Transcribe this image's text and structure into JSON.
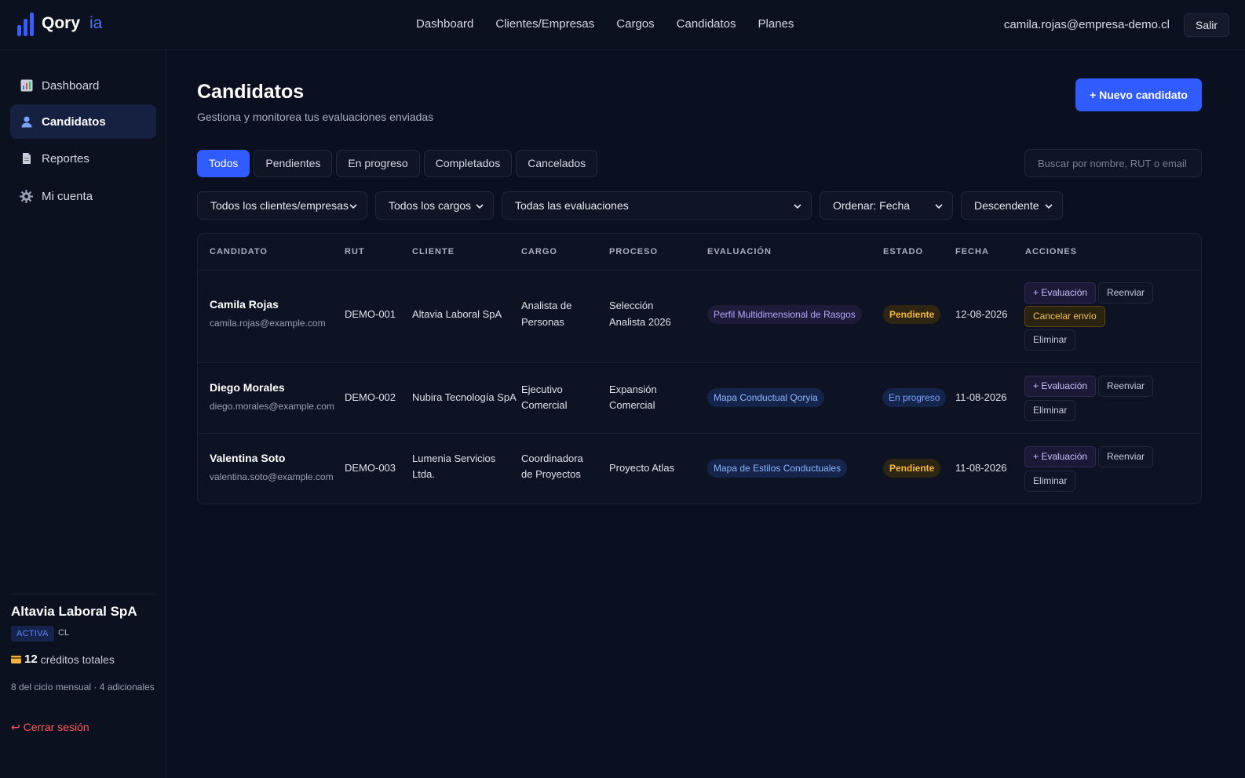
{
  "app": {
    "logo_main": "Qory",
    "logo_accent": "ia"
  },
  "topnav": [
    "Dashboard",
    "Clientes/Empresas",
    "Cargos",
    "Candidatos",
    "Planes"
  ],
  "user": {
    "email": "camila.rojas@empresa-demo.cl",
    "logout_label": "Salir"
  },
  "sidebar": {
    "items": [
      {
        "label": "Dashboard",
        "icon": "chart-icon"
      },
      {
        "label": "Candidatos",
        "icon": "user-icon",
        "active": true
      },
      {
        "label": "Reportes",
        "icon": "document-icon"
      },
      {
        "label": "Mi cuenta",
        "icon": "gear-icon"
      }
    ],
    "company": {
      "name": "Altavia Laboral SpA",
      "status": "ACTIVA",
      "country": "CL",
      "credits_count": "12",
      "credits_label": "créditos totales",
      "cycle": "8 del ciclo mensual · 4 adicionales"
    },
    "logout": "↩ Cerrar sesión"
  },
  "page": {
    "title": "Candidatos",
    "subtitle": "Gestiona y monitorea tus evaluaciones enviadas",
    "new_button": "+ Nuevo candidato"
  },
  "tabs": [
    "Todos",
    "Pendientes",
    "En progreso",
    "Completados",
    "Cancelados"
  ],
  "search": {
    "placeholder": "Buscar por nombre, RUT o email"
  },
  "filters": {
    "cliente": "Todos los clientes/empresas",
    "cargo": "Todos los cargos",
    "evaluacion": "Todas las evaluaciones",
    "orden": "Ordenar: Fecha",
    "direccion": "Descendente"
  },
  "table": {
    "headers": [
      "CANDIDATO",
      "RUT",
      "CLIENTE",
      "CARGO",
      "PROCESO",
      "EVALUACIÓN",
      "ESTADO",
      "FECHA",
      "ACCIONES"
    ],
    "rows": [
      {
        "name": "Camila Rojas",
        "email": "camila.rojas@example.com",
        "rut": "DEMO-001",
        "cliente": [
          "Altavia Laboral SpA"
        ],
        "cargo": [
          "Analista de",
          "Personas"
        ],
        "proceso": [
          "Selección",
          "Analista 2026"
        ],
        "evaluacion": "Perfil Multidimensional de Rasgos",
        "estado": "Pendiente",
        "fecha": "12-08-2026",
        "acciones": {
          "evaluacion": "+ Evaluación",
          "reenviar": "Reenviar",
          "cancelar": "Cancelar envío",
          "eliminar": "Eliminar"
        }
      },
      {
        "name": "Diego Morales",
        "email": "diego.morales@example.com",
        "rut": "DEMO-002",
        "cliente": [
          "Nubira Tecnología SpA"
        ],
        "cargo": [
          "Ejecutivo",
          "Comercial"
        ],
        "proceso": [
          "Expansión",
          "Comercial"
        ],
        "evaluacion": "Mapa Conductual Qoryia",
        "estado": "En progreso",
        "fecha": "11-08-2026",
        "acciones": {
          "evaluacion": "+ Evaluación",
          "reenviar": "Reenviar",
          "eliminar": "Eliminar"
        }
      },
      {
        "name": "Valentina Soto",
        "email": "valentina.soto@example.com",
        "rut": "DEMO-003",
        "cliente": [
          "Lumenia Servicios",
          "Ltda."
        ],
        "cargo": [
          "Coordinadora",
          "de Proyectos"
        ],
        "proceso": [
          "Proyecto Atlas"
        ],
        "evaluacion": "Mapa de Estilos Conductuales",
        "estado": "Pendiente",
        "fecha": "11-08-2026",
        "acciones": {
          "evaluacion": "+ Evaluación",
          "reenviar": "Reenviar",
          "eliminar": "Eliminar"
        }
      }
    ]
  },
  "colors": {
    "accent": "#2f5bff",
    "pending": "#f5b73a",
    "in_progress": "#7ea6ff",
    "danger": "#ff5a5a"
  }
}
